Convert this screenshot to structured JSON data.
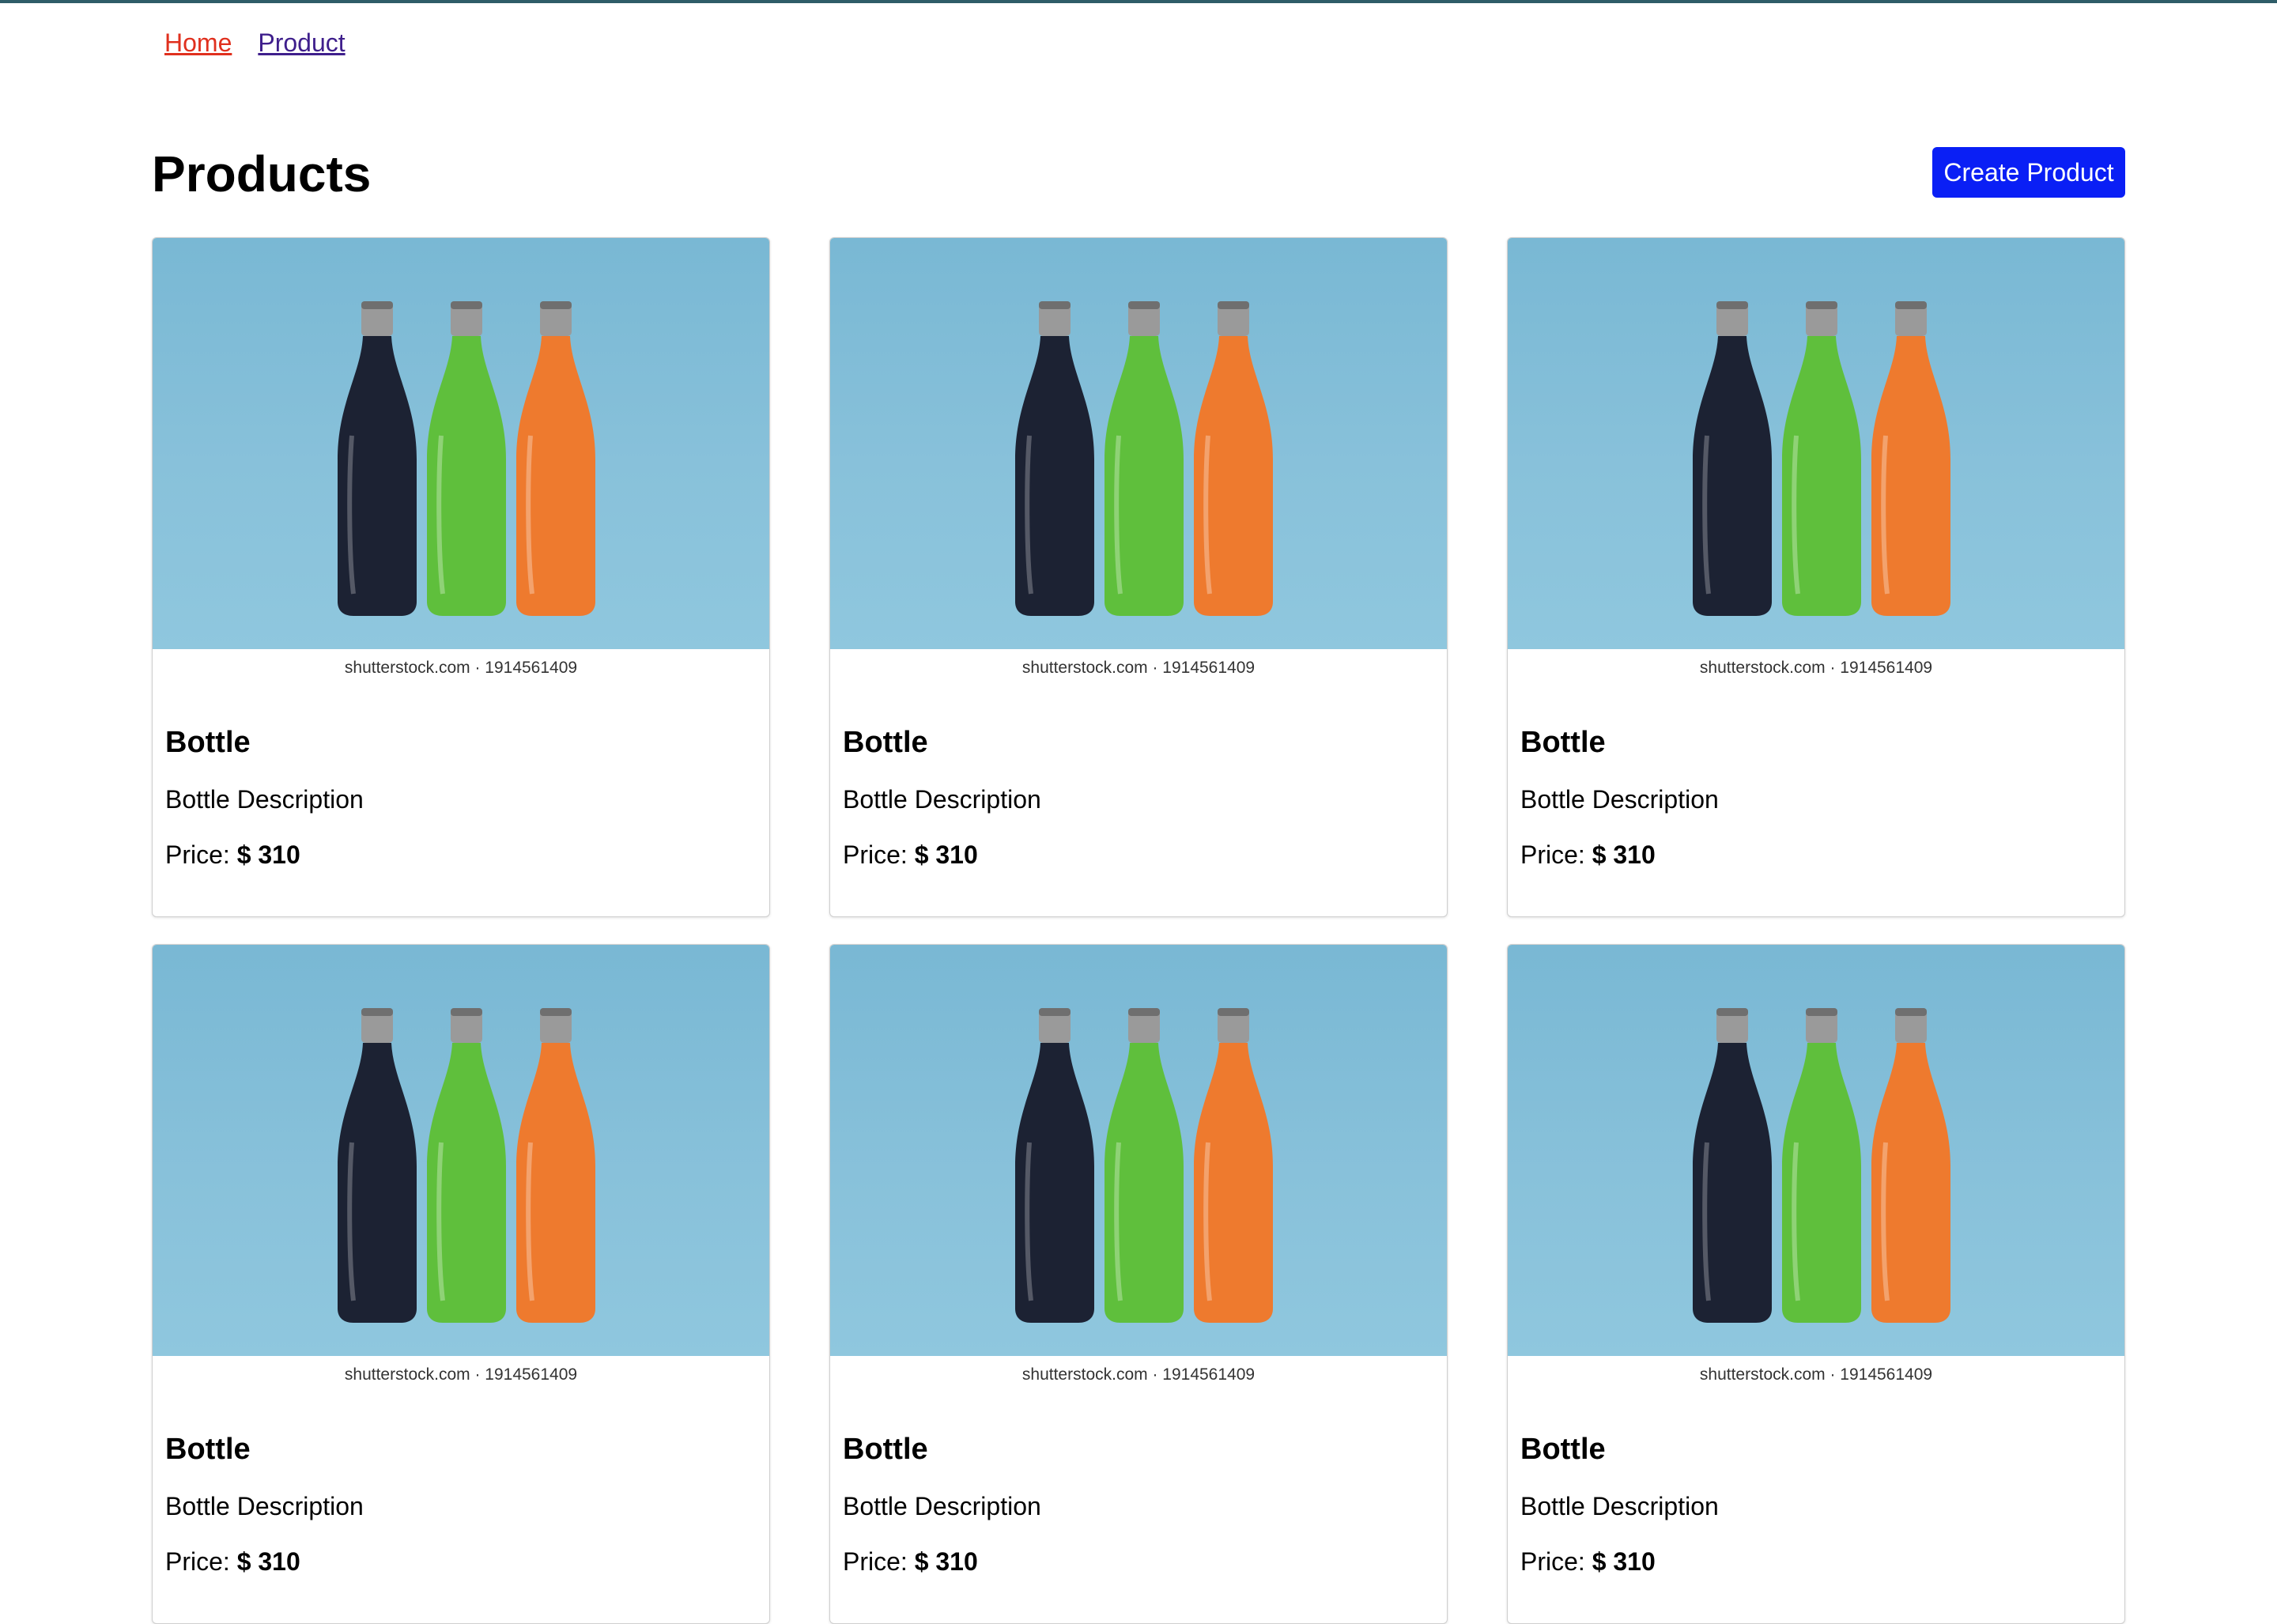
{
  "nav": {
    "items": [
      {
        "label": "Home"
      },
      {
        "label": "Product"
      }
    ]
  },
  "page": {
    "title": "Products",
    "create_button_label": "Create Product"
  },
  "products": [
    {
      "name": "Bottle",
      "description": "Bottle Description",
      "price_label": "Price:",
      "price": "$ 310",
      "image_credit": "shutterstock.com · 1914561409"
    },
    {
      "name": "Bottle",
      "description": "Bottle Description",
      "price_label": "Price:",
      "price": "$ 310",
      "image_credit": "shutterstock.com · 1914561409"
    },
    {
      "name": "Bottle",
      "description": "Bottle Description",
      "price_label": "Price:",
      "price": "$ 310",
      "image_credit": "shutterstock.com · 1914561409"
    },
    {
      "name": "Bottle",
      "description": "Bottle Description",
      "price_label": "Price:",
      "price": "$ 310",
      "image_credit": "shutterstock.com · 1914561409"
    },
    {
      "name": "Bottle",
      "description": "Bottle Description",
      "price_label": "Price:",
      "price": "$ 310",
      "image_credit": "shutterstock.com · 1914561409"
    },
    {
      "name": "Bottle",
      "description": "Bottle Description",
      "price_label": "Price:",
      "price": "$ 310",
      "image_credit": "shutterstock.com · 1914561409"
    }
  ],
  "colors": {
    "top_bar": "#2f5d68",
    "nav_home": "#e0301e",
    "nav_product": "#3f1f8c",
    "create_button_bg": "#0a1ff5",
    "image_bg": "#88c1da",
    "bottle_black": "#1c2233",
    "bottle_green": "#5fbf3c",
    "bottle_orange": "#ee7a2e",
    "bottle_cap": "#9a9a9a"
  }
}
